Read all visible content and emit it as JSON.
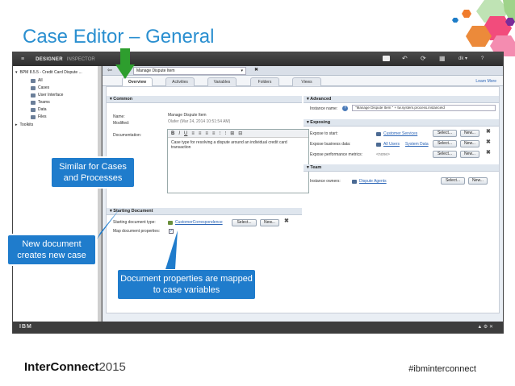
{
  "slide": {
    "title": "Case Editor – General",
    "footer_brand": "InterConnect",
    "footer_year": "2015",
    "hashtag": "#ibminterconnect"
  },
  "app": {
    "topbar": {
      "brand": "DESIGNER",
      "inspector": "INSPECTOR",
      "user": "dk ▾",
      "help": "?"
    },
    "tree": {
      "root": "BPM 8.5.5 - Credit Card Dispute ...",
      "items": [
        "All",
        "Cases",
        "User Interface",
        "Teams",
        "Data",
        "Files"
      ],
      "toolkits": "Toolkits"
    },
    "doc_tab": "Manage Dispute Item",
    "tabs": [
      "Overview",
      "Activities",
      "Variables",
      "Folders",
      "Views"
    ],
    "learn_more": "Learn More",
    "common": {
      "header": "Common",
      "name_label": "Name:",
      "name_value": "Manage Dispute Item",
      "modified_label": "Modified:",
      "modified_value": "Olafer (Mar 24, 2014 10:51:54 AM)",
      "doc_label": "Documentation:",
      "doc_text": "Case type for resolving a dispute around an individual credit card transaction",
      "tools": [
        "B",
        "I",
        "U",
        "≡",
        "≡",
        "≡",
        "≡",
        "⁝",
        "⁝",
        "⊞",
        "⊟"
      ]
    },
    "starting": {
      "header": "Starting Document",
      "type_label": "Starting document type:",
      "type_value": "CustomerCorrespondence",
      "map_label": "Map document properties:",
      "select": "Select...",
      "new": "New..."
    },
    "advanced": {
      "header": "Advanced",
      "instance_label": "Instance name:",
      "instance_value": "\"Manage Dispute Item \" + tw.system.process.instanceId"
    },
    "exposing": {
      "header": "Exposing",
      "rows": [
        {
          "label": "Expose to start:",
          "value": "Customer Services"
        },
        {
          "label": "Expose business data:",
          "value": "All Users",
          "value2": "System Data"
        },
        {
          "label": "Expose performance metrics:",
          "value": "<none>"
        }
      ],
      "select": "Select...",
      "new": "New..."
    },
    "team": {
      "header": "Team",
      "owners_label": "Instance owners:",
      "owners_value": "Dispute Agents",
      "select": "Select...",
      "new": "New..."
    },
    "statusbar": {
      "left": "IBM"
    }
  },
  "callouts": {
    "cases": "Similar for Cases and Processes",
    "newdoc": "New document creates new case",
    "props": "Document properties are mapped to case variables"
  }
}
